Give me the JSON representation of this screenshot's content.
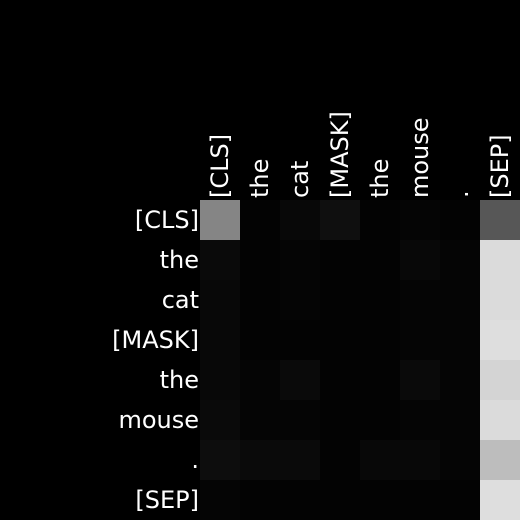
{
  "chart_data": {
    "type": "heatmap",
    "title": "",
    "xlabel": "",
    "ylabel": "",
    "x_labels": [
      "[CLS]",
      "the",
      "cat",
      "[MASK]",
      "the",
      "mouse",
      ".",
      "[SEP]"
    ],
    "y_labels": [
      "[CLS]",
      "the",
      "cat",
      "[MASK]",
      "the",
      "mouse",
      ".",
      "[SEP]"
    ],
    "x_labels_position": "top",
    "x_labels_rotation": "vertical",
    "colormap": "grayscale",
    "background_color": "#000000",
    "value_range": [
      0,
      1
    ],
    "values": [
      [
        0.52,
        0.01,
        0.03,
        0.06,
        0.01,
        0.02,
        0.01,
        0.34
      ],
      [
        0.04,
        0.01,
        0.02,
        0.01,
        0.01,
        0.03,
        0.02,
        0.86
      ],
      [
        0.03,
        0.01,
        0.02,
        0.01,
        0.01,
        0.02,
        0.02,
        0.86
      ],
      [
        0.03,
        0.01,
        0.01,
        0.01,
        0.01,
        0.02,
        0.02,
        0.87
      ],
      [
        0.03,
        0.02,
        0.04,
        0.01,
        0.01,
        0.04,
        0.02,
        0.83
      ],
      [
        0.04,
        0.02,
        0.02,
        0.01,
        0.01,
        0.02,
        0.02,
        0.86
      ],
      [
        0.05,
        0.04,
        0.04,
        0.01,
        0.03,
        0.03,
        0.02,
        0.74
      ],
      [
        0.02,
        0.01,
        0.01,
        0.01,
        0.01,
        0.01,
        0.01,
        0.87
      ]
    ]
  }
}
